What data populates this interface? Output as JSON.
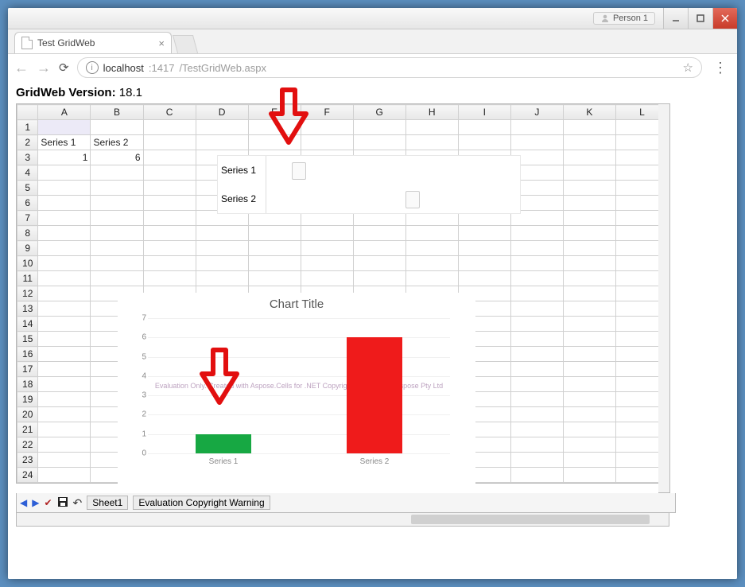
{
  "window": {
    "person_label": "Person 1"
  },
  "browser": {
    "tab_title": "Test GridWeb",
    "url_host": "localhost",
    "url_port": ":1417",
    "url_path": "/TestGridWeb.aspx"
  },
  "page": {
    "version_label": "GridWeb Version:",
    "version_value": "18.1"
  },
  "grid": {
    "columns": [
      "A",
      "B",
      "C",
      "D",
      "E",
      "F",
      "G",
      "H",
      "I",
      "J",
      "K",
      "L"
    ],
    "row_count": 24,
    "cells": {
      "A2": "Series 1",
      "B2": "Series 2",
      "A3": "1",
      "B3": "6"
    }
  },
  "overlay_minichart": {
    "rows": [
      {
        "label": "Series 1",
        "marker_pct": 10
      },
      {
        "label": "Series 2",
        "marker_pct": 55
      }
    ]
  },
  "chart_data": {
    "type": "bar",
    "title": "Chart Title",
    "categories": [
      "Series 1",
      "Series 2"
    ],
    "values": [
      1,
      6
    ],
    "colors": [
      "#17a843",
      "#ef1b1b"
    ],
    "ylim": [
      0,
      7
    ],
    "yticks": [
      0,
      1,
      2,
      3,
      4,
      5,
      6,
      7
    ],
    "watermark": "Evaluation Only. Created with Aspose.Cells for .NET Copyright 2003 - 2018 Aspose Pty Ltd"
  },
  "toolbar": {
    "sheet_label": "Sheet1",
    "warning_label": "Evaluation Copyright Warning"
  }
}
